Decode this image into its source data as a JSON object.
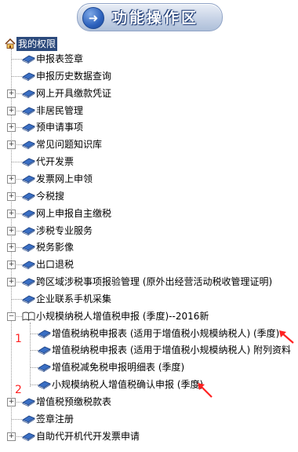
{
  "header": {
    "title": "功能操作区"
  },
  "tree": {
    "root_label": "我的权限",
    "items": [
      {
        "label": "申报表签章",
        "expandable": false
      },
      {
        "label": "申报历史数据查询",
        "expandable": false
      },
      {
        "label": "网上开具缴款凭证",
        "expandable": true
      },
      {
        "label": "非居民管理",
        "expandable": true
      },
      {
        "label": "预申请事项",
        "expandable": true
      },
      {
        "label": "常见问题知识库",
        "expandable": true
      },
      {
        "label": "代开发票",
        "expandable": false
      },
      {
        "label": "发票网上申领",
        "expandable": true
      },
      {
        "label": "今税搜",
        "expandable": true
      },
      {
        "label": "网上申报自主缴税",
        "expandable": true
      },
      {
        "label": "涉税专业服务",
        "expandable": true
      },
      {
        "label": "税务影像",
        "expandable": true
      },
      {
        "label": "出口退税",
        "expandable": true
      },
      {
        "label": "跨区域涉税事项报验管理 (原外出经营活动税收管理证明)",
        "expandable": true
      },
      {
        "label": "企业联系手机采集",
        "expandable": false
      },
      {
        "label": "小规模纳税人增值税申报 (季度)--2016新",
        "expandable": true,
        "expanded": true
      },
      {
        "label": "增值税预缴税款表",
        "expandable": true
      },
      {
        "label": "签章注册",
        "expandable": false
      },
      {
        "label": "自助代开机代开发票申请",
        "expandable": true
      }
    ],
    "subitems": [
      "增值税纳税申报表 (适用于增值税小规模纳税人) (季度)",
      "增值税纳税申报表 (适用于增值税小规模纳税人) 附列资料",
      "增值税减免税申报明细表 (季度)",
      "小规模纳税人增值税确认申报 (季度)"
    ]
  },
  "annotations": {
    "marker_1": "1",
    "marker_2": "2",
    "arrow_color": "#ff2222"
  }
}
